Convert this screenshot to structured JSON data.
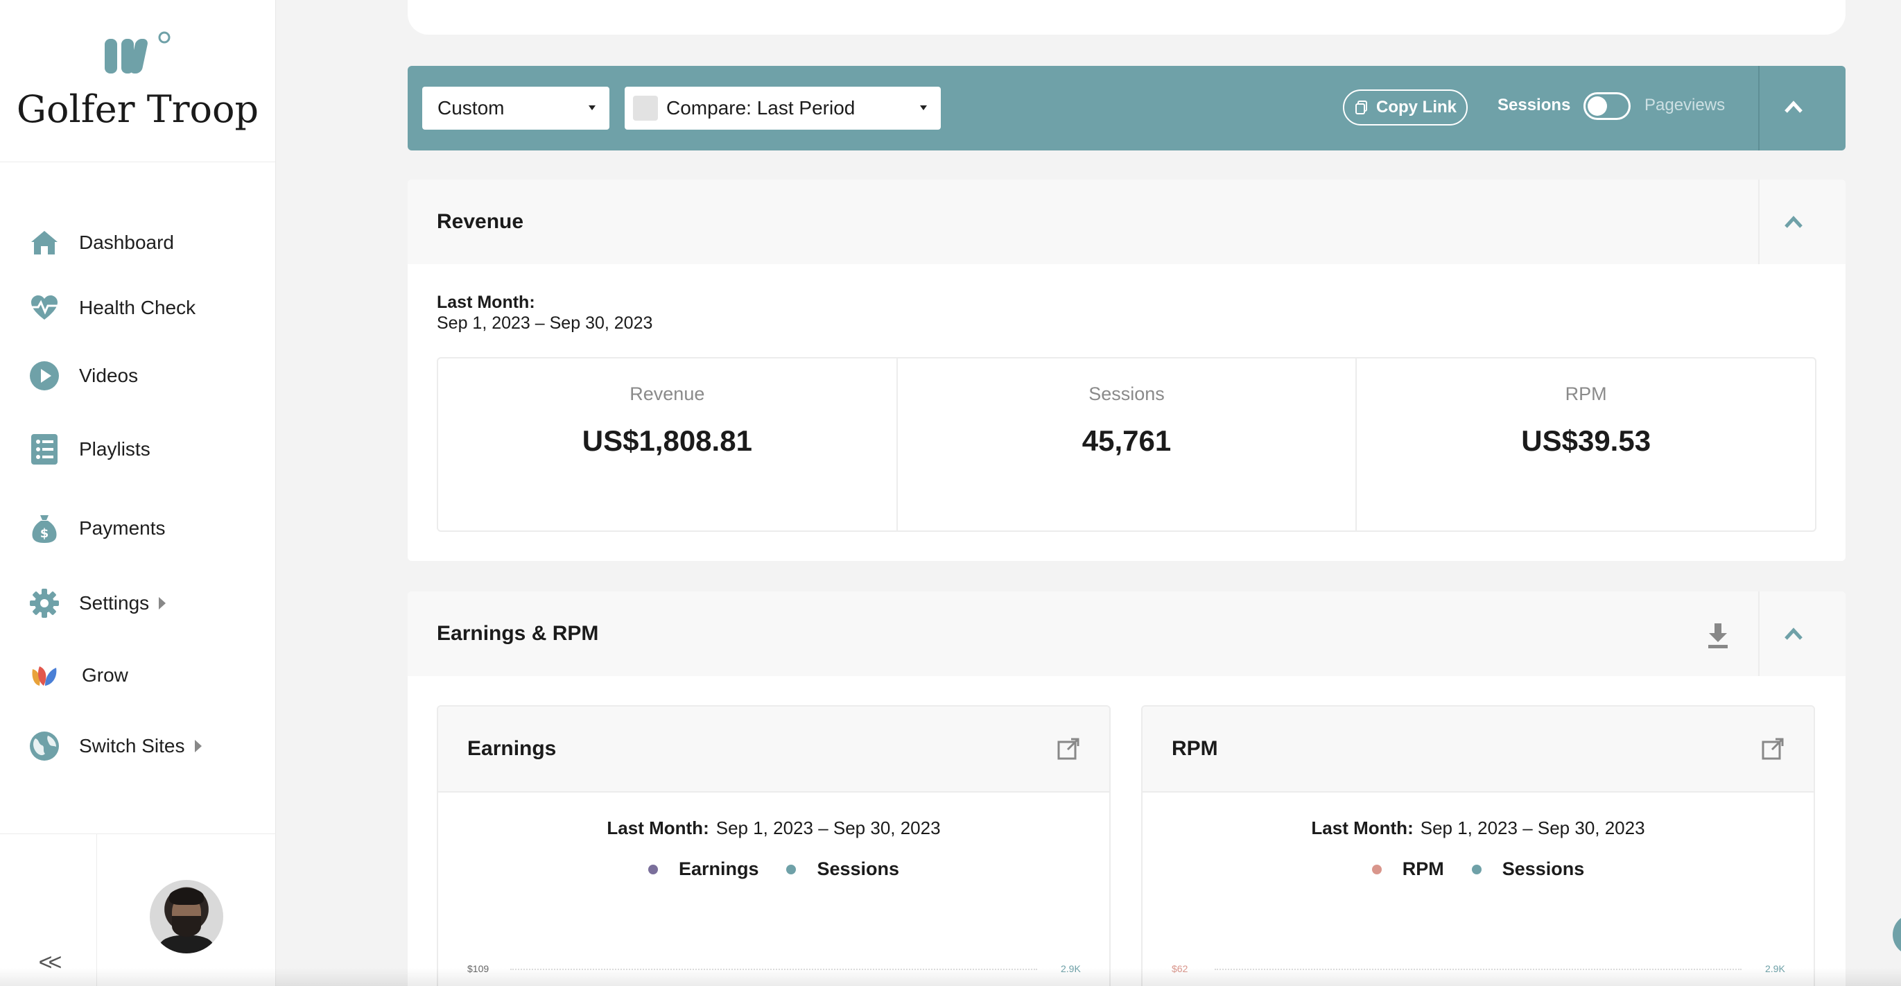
{
  "brand": {
    "name": "Golfer Troop"
  },
  "colors": {
    "accent": "#6fa1a8",
    "earnings_dot": "#7a6f9b",
    "sessions_dot": "#6fa1a8",
    "rpm_dot": "#d9968c"
  },
  "sidebar": {
    "items": [
      {
        "label": "Dashboard",
        "icon": "home-icon"
      },
      {
        "label": "Health Check",
        "icon": "heartbeat-icon"
      },
      {
        "label": "Videos",
        "icon": "play-icon"
      },
      {
        "label": "Playlists",
        "icon": "list-icon"
      },
      {
        "label": "Payments",
        "icon": "money-bag-icon"
      },
      {
        "label": "Settings",
        "icon": "gear-icon"
      },
      {
        "label": "Grow",
        "icon": "grow-logo-icon"
      },
      {
        "label": "Switch Sites",
        "icon": "globe-icon"
      }
    ],
    "collapse_label": "<<"
  },
  "toolbar": {
    "date_select": "Custom",
    "compare_select": "Compare: Last Period",
    "copy_link": "Copy Link",
    "toggle_left": "Sessions",
    "toggle_right": "Pageviews"
  },
  "revenue": {
    "title": "Revenue",
    "range_label": "Last Month:",
    "range_value": "Sep 1, 2023 – Sep 30, 2023",
    "metrics": [
      {
        "label": "Revenue",
        "value": "US$1,808.81"
      },
      {
        "label": "Sessions",
        "value": "45,761"
      },
      {
        "label": "RPM",
        "value": "US$39.53"
      }
    ]
  },
  "earnings_rpm": {
    "title": "Earnings & RPM",
    "earnings_card": {
      "title": "Earnings",
      "range_label": "Last Month:",
      "range_value": "Sep 1, 2023 – Sep 30, 2023",
      "legend": [
        "Earnings",
        "Sessions"
      ],
      "y_left_top": "$109",
      "y_right_top": "2.9K"
    },
    "rpm_card": {
      "title": "RPM",
      "range_label": "Last Month:",
      "range_value": "Sep 1, 2023 – Sep 30, 2023",
      "legend": [
        "RPM",
        "Sessions"
      ],
      "y_left_top": "$62",
      "y_right_top": "2.9K"
    }
  }
}
